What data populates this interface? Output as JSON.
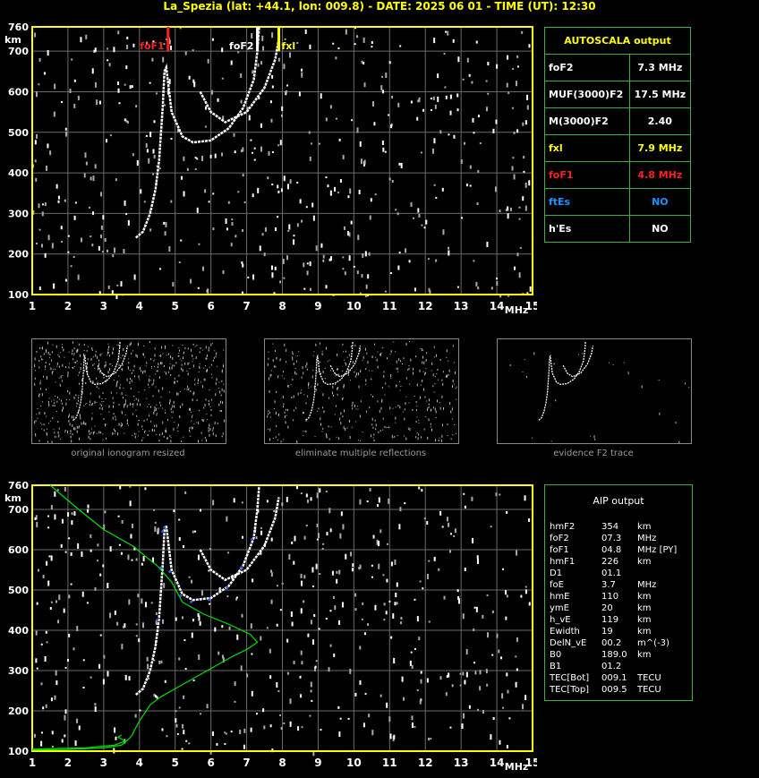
{
  "title": "La_Spezia (lat: +44.1, lon: 009.8) - DATE: 2025 06 01 - TIME (UT): 12:30",
  "autoscala": {
    "title": "AUTOSCALA output",
    "rows": [
      {
        "label": "foF2",
        "value": "7.3 MHz",
        "color": "#ffffff"
      },
      {
        "label": "MUF(3000)F2",
        "value": "17.5 MHz",
        "color": "#ffffff"
      },
      {
        "label": "M(3000)F2",
        "value": "2.40",
        "color": "#ffffff"
      },
      {
        "label": "fxl",
        "value": "7.9 MHz",
        "color": "#ffff00"
      },
      {
        "label": "foF1",
        "value": "4.8 MHz",
        "color": "#ff2020"
      },
      {
        "label": "ftEs",
        "value": "NO",
        "color": "#1e90ff"
      },
      {
        "label": "h'Es",
        "value": "NO",
        "color": "#ffffff"
      }
    ]
  },
  "aip": {
    "title": "AIP output",
    "rows": [
      {
        "name": "hmF2",
        "val": "354",
        "unit": "km"
      },
      {
        "name": "foF2",
        "val": "07.3",
        "unit": "MHz"
      },
      {
        "name": "foF1",
        "val": "04.8",
        "unit": "MHz   [PY]"
      },
      {
        "name": "hmF1",
        "val": "226",
        "unit": "km"
      },
      {
        "name": "D1",
        "val": "01.1",
        "unit": ""
      },
      {
        "name": "foE",
        "val": "3.7",
        "unit": "MHz"
      },
      {
        "name": "hmE",
        "val": "110",
        "unit": "km"
      },
      {
        "name": "ymE",
        "val": "20",
        "unit": "km"
      },
      {
        "name": "h_vE",
        "val": "119",
        "unit": "km"
      },
      {
        "name": "Ewidth",
        "val": "19",
        "unit": "km"
      },
      {
        "name": "DelN_vE",
        "val": "00.2",
        "unit": "m^(-3)"
      },
      {
        "name": "B0",
        "val": "189.0",
        "unit": "km"
      },
      {
        "name": "B1",
        "val": "01.2",
        "unit": ""
      },
      {
        "name": "TEC[Bot]",
        "val": "009.1",
        "unit": "TECU"
      },
      {
        "name": "TEC[Top]",
        "val": "009.5",
        "unit": "TECU"
      }
    ]
  },
  "thumbnails": [
    {
      "caption": "original ionogram resized"
    },
    {
      "caption": "eliminate multiple reflections"
    },
    {
      "caption": "evidence F2 trace"
    }
  ],
  "chart_data": [
    {
      "type": "scatter",
      "panel": "autoscala-ionogram",
      "xlabel": "MHz",
      "ylabel": "km",
      "xlim": [
        1,
        15
      ],
      "ylim": [
        100,
        760
      ],
      "xticks": [
        1,
        2,
        3,
        4,
        5,
        6,
        7,
        8,
        9,
        10,
        11,
        12,
        13,
        14,
        15
      ],
      "yticks": [
        100,
        200,
        300,
        400,
        500,
        600,
        700,
        760
      ],
      "grid": true,
      "markers": [
        {
          "label": "foF1",
          "x": 4.8,
          "color": "#ff2020"
        },
        {
          "label": "foF2",
          "x": 7.3,
          "color": "#ffffff"
        },
        {
          "label": "fxl",
          "x": 7.9,
          "color": "#ffff00"
        }
      ],
      "traces": [
        {
          "name": "O-mode F trace",
          "color": "#ffffff",
          "points": [
            [
              3.9,
              240
            ],
            [
              4.1,
              255
            ],
            [
              4.3,
              300
            ],
            [
              4.45,
              360
            ],
            [
              4.55,
              430
            ],
            [
              4.65,
              560
            ],
            [
              4.7,
              650
            ],
            [
              4.75,
              660
            ],
            [
              4.9,
              550
            ],
            [
              5.2,
              490
            ],
            [
              5.5,
              475
            ],
            [
              6.0,
              480
            ],
            [
              6.5,
              510
            ],
            [
              6.9,
              560
            ],
            [
              7.2,
              630
            ],
            [
              7.3,
              700
            ],
            [
              7.35,
              760
            ]
          ]
        },
        {
          "name": "X-mode F trace",
          "color": "#ffffff",
          "points": [
            [
              5.7,
              600
            ],
            [
              6.0,
              550
            ],
            [
              6.4,
              525
            ],
            [
              7.0,
              550
            ],
            [
              7.5,
              610
            ],
            [
              7.8,
              680
            ],
            [
              7.9,
              730
            ]
          ]
        }
      ]
    },
    {
      "type": "line",
      "panel": "aip-ionogram",
      "xlabel": "MHz",
      "ylabel": "km",
      "xlim": [
        1,
        15
      ],
      "ylim": [
        100,
        760
      ],
      "xticks": [
        1,
        2,
        3,
        4,
        5,
        6,
        7,
        8,
        9,
        10,
        11,
        12,
        13,
        14,
        15
      ],
      "yticks": [
        100,
        200,
        300,
        400,
        500,
        600,
        700,
        760
      ],
      "grid": true,
      "profile": {
        "color": "#00e000",
        "points": [
          [
            1,
            103
          ],
          [
            2,
            104
          ],
          [
            3,
            108
          ],
          [
            3.5,
            115
          ],
          [
            3.7,
            130
          ],
          [
            3.8,
            140
          ],
          [
            3.85,
            150
          ],
          [
            4.0,
            175
          ],
          [
            4.3,
            215
          ],
          [
            4.6,
            235
          ],
          [
            4.7,
            240
          ],
          [
            4.8,
            245
          ],
          [
            5.3,
            270
          ],
          [
            6.0,
            305
          ],
          [
            6.6,
            335
          ],
          [
            7.0,
            352
          ],
          [
            7.3,
            370
          ],
          [
            7.1,
            390
          ],
          [
            6.5,
            415
          ],
          [
            5.8,
            440
          ],
          [
            5.2,
            470
          ],
          [
            4.9,
            520
          ],
          [
            4.5,
            560
          ],
          [
            3.8,
            610
          ],
          [
            3.0,
            650
          ],
          [
            2.3,
            700
          ],
          [
            1.5,
            760
          ]
        ]
      },
      "virtual_height": {
        "color": "#00e000",
        "points": [
          [
            1,
            105
          ],
          [
            2.5,
            108
          ],
          [
            3.3,
            115
          ],
          [
            3.6,
            125
          ],
          [
            3.4,
            135
          ],
          [
            3.5,
            140
          ]
        ]
      },
      "traces": [
        {
          "name": "O-mode F trace",
          "color": "#ffffff",
          "points": [
            [
              3.9,
              240
            ],
            [
              4.1,
              255
            ],
            [
              4.3,
              300
            ],
            [
              4.45,
              360
            ],
            [
              4.55,
              430
            ],
            [
              4.65,
              560
            ],
            [
              4.7,
              650
            ],
            [
              4.75,
              660
            ],
            [
              4.9,
              550
            ],
            [
              5.2,
              490
            ],
            [
              5.5,
              475
            ],
            [
              6.0,
              480
            ],
            [
              6.5,
              510
            ],
            [
              6.9,
              560
            ],
            [
              7.2,
              630
            ],
            [
              7.3,
              700
            ],
            [
              7.35,
              760
            ]
          ]
        },
        {
          "name": "X-mode F trace",
          "color": "#ffffff",
          "points": [
            [
              5.7,
              600
            ],
            [
              6.0,
              550
            ],
            [
              6.4,
              525
            ],
            [
              7.0,
              550
            ],
            [
              7.5,
              610
            ],
            [
              7.8,
              680
            ],
            [
              7.9,
              730
            ]
          ]
        }
      ]
    }
  ]
}
